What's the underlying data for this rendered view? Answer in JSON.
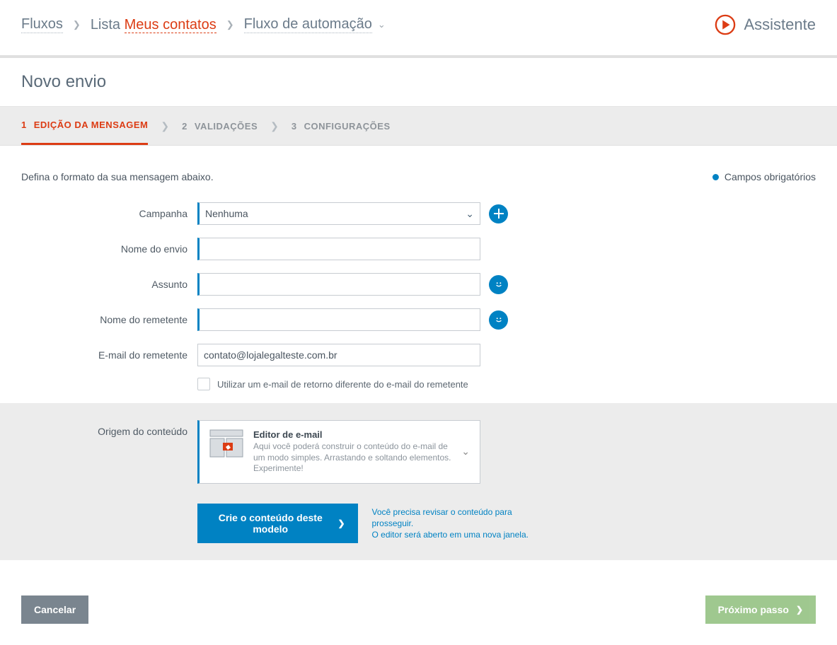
{
  "breadcrumb": {
    "fluxos": "Fluxos",
    "lista_prefix": "Lista",
    "lista_name": "Meus contatos",
    "fluxo_auto": "Fluxo de automação"
  },
  "assistant_label": "Assistente",
  "page_title": "Novo envio",
  "steps": [
    {
      "num": "1",
      "label": "EDIÇÃO DA MENSAGEM"
    },
    {
      "num": "2",
      "label": "VALIDAÇÕES"
    },
    {
      "num": "3",
      "label": "CONFIGURAÇÕES"
    }
  ],
  "intro_text": "Defina o formato da sua mensagem abaixo.",
  "required_label": "Campos obrigatórios",
  "form": {
    "campaign": {
      "label": "Campanha",
      "value": "Nenhuma"
    },
    "send_name": {
      "label": "Nome do envio",
      "value": ""
    },
    "subject": {
      "label": "Assunto",
      "value": ""
    },
    "sender_name": {
      "label": "Nome do remetente",
      "value": ""
    },
    "sender_email": {
      "label": "E-mail do remetente",
      "value": "contato@lojalegalteste.com.br"
    },
    "reply_checkbox": "Utilizar um e-mail de retorno diferente do e-mail do remetente",
    "origin": {
      "label": "Origem do conteúdo",
      "title": "Editor de e-mail",
      "desc": "Aqui você poderá construir o conteúdo do e-mail de um modo simples. Arrastando e soltando elementos. Experimente!"
    }
  },
  "cta_button": "Crie o conteúdo deste modelo",
  "cta_note": "Você precisa revisar o conteúdo para prosseguir.\nO editor será aberto em uma nova janela.",
  "cancel_label": "Cancelar",
  "next_label": "Próximo passo"
}
